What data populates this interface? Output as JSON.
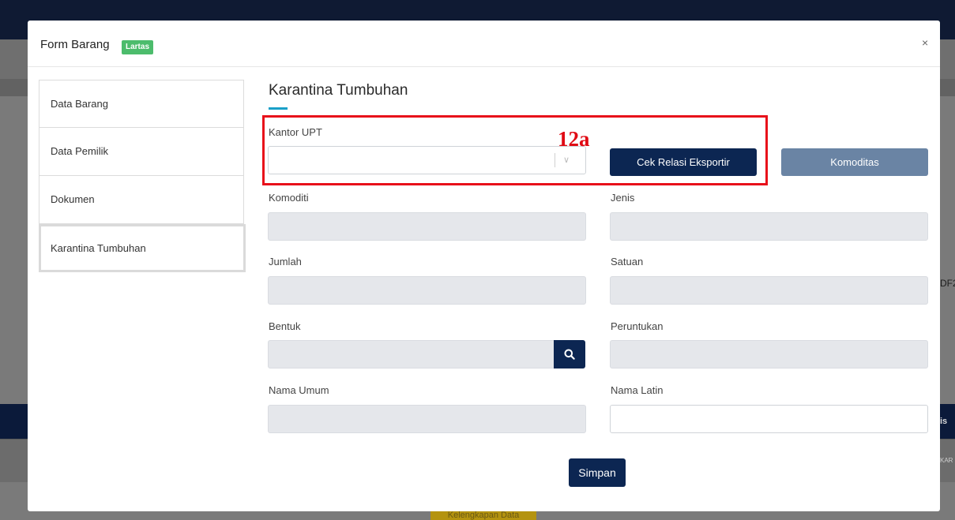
{
  "background": {
    "right_text": "DF2",
    "right_band_text": "is",
    "right_small_text": "KAR",
    "gold_button_text": "Kelengkapan Data"
  },
  "modal": {
    "title": "Form Barang",
    "badge": "Lartas",
    "close_icon": "×"
  },
  "sidebar": {
    "items": [
      {
        "label": "Data Barang",
        "active": false
      },
      {
        "label": "Data Pemilik",
        "active": false
      },
      {
        "label": "Dokumen",
        "active": false
      },
      {
        "label": "Karantina Tumbuhan",
        "active": true
      }
    ]
  },
  "section": {
    "title": "Karantina Tumbuhan"
  },
  "form": {
    "kantor_upt": {
      "label": "Kantor UPT",
      "value": ""
    },
    "cek_relasi_button": "Cek Relasi Eksportir",
    "komoditas_button": "Komoditas",
    "komoditi": {
      "label": "Komoditi",
      "value": ""
    },
    "jenis": {
      "label": "Jenis",
      "value": ""
    },
    "jumlah": {
      "label": "Jumlah",
      "value": ""
    },
    "satuan": {
      "label": "Satuan",
      "value": ""
    },
    "bentuk": {
      "label": "Bentuk",
      "value": ""
    },
    "peruntukan": {
      "label": "Peruntukan",
      "value": ""
    },
    "nama_umum": {
      "label": "Nama Umum",
      "value": ""
    },
    "nama_latin": {
      "label": "Nama Latin",
      "value": ""
    },
    "simpan_button": "Simpan"
  },
  "annotation": {
    "label": "12a",
    "color": "#e8101a"
  },
  "colors": {
    "primary": "#0c2652",
    "muted_button": "#6a84a4",
    "badge": "#4cbc6c",
    "accent_underline": "#1aa0c8"
  }
}
